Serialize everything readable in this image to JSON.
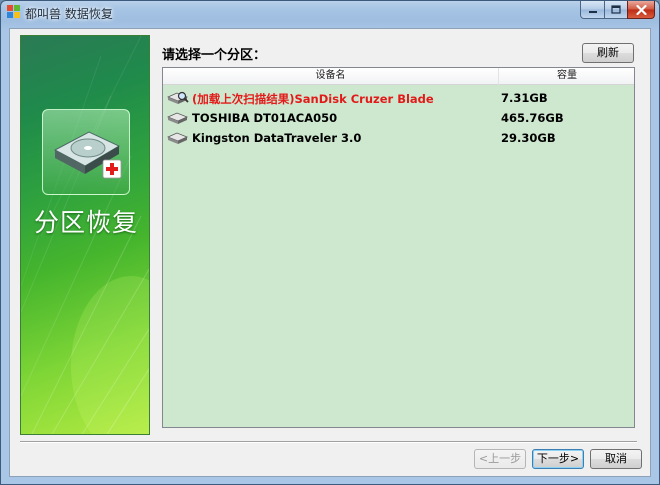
{
  "window": {
    "title": "都叫兽 数据恢复"
  },
  "banner": {
    "title": "分区恢复"
  },
  "main": {
    "prompt": "请选择一个分区：",
    "refresh_label": "刷新",
    "columns": {
      "device_name": "设备名",
      "capacity": "容量"
    },
    "devices": [
      {
        "name": "(加载上次扫描结果)SanDisk Cruzer Blade",
        "capacity": "7.31GB",
        "highlighted": true
      },
      {
        "name": "TOSHIBA DT01ACA050",
        "capacity": "465.76GB",
        "highlighted": false
      },
      {
        "name": "Kingston DataTraveler 3.0",
        "capacity": "29.30GB",
        "highlighted": false
      }
    ]
  },
  "footer": {
    "prev_label": "<上一步",
    "next_label": "下一步>",
    "cancel_label": "取消"
  },
  "icons": {
    "app": "app-logo-icon",
    "minimize": "minimize-icon",
    "maximize": "maximize-icon",
    "close": "close-icon",
    "banner_disk": "hard-disk-restore-icon",
    "device_scan": "drive-magnifier-icon",
    "device_drive": "drive-icon"
  },
  "colors": {
    "list_background": "#cde8cf",
    "highlight_text": "#e31a1a",
    "banner_green": "#2fa23e"
  }
}
